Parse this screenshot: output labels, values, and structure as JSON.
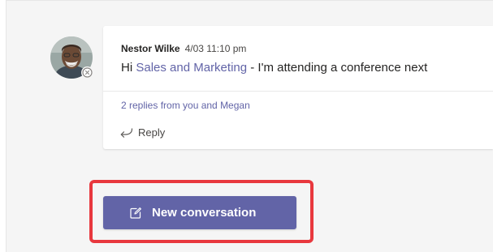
{
  "message": {
    "author": "Nestor Wilke",
    "timestamp": "4/03 11:10 pm",
    "greeting": "Hi ",
    "mention": "Sales and Marketing",
    "body_rest": " - I'm attending a conference next",
    "replies_text": "2 replies from you and Megan",
    "reply_label": "Reply"
  },
  "compose": {
    "new_conversation_label": "New conversation"
  },
  "colors": {
    "accent": "#6264a7",
    "highlight": "#e8383e"
  },
  "icons": {
    "avatar": "avatar",
    "presence": "presence-status-icon",
    "reply": "reply-arrow-icon",
    "compose": "compose-icon"
  }
}
